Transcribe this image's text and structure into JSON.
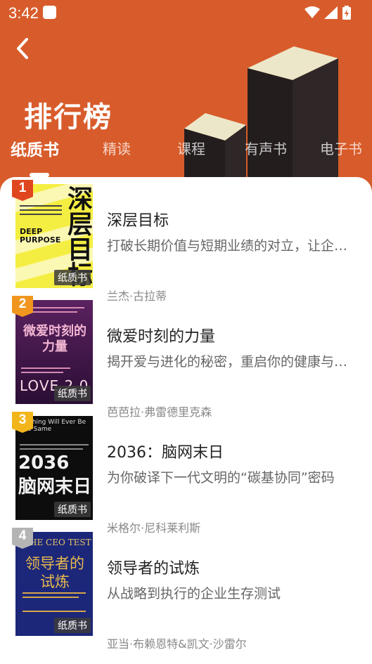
{
  "status": {
    "time": "3:42"
  },
  "header": {
    "title": "排行榜"
  },
  "tabs": [
    {
      "label": "纸质书",
      "active": true
    },
    {
      "label": "精读",
      "active": false
    },
    {
      "label": "课程",
      "active": false
    },
    {
      "label": "有声书",
      "active": false
    },
    {
      "label": "电子书",
      "active": false
    }
  ],
  "books": [
    {
      "rank": "1",
      "title": "深层目标",
      "desc": "打破长期价值与短期业绩的对立，让企业行稳致远",
      "author": "兰杰·古拉蒂",
      "tag": "纸质书",
      "cover_title": "深层目标",
      "cover_sub": "DEEP PURPOSE"
    },
    {
      "rank": "2",
      "title": "微爱时刻的力量",
      "desc": "揭开爱与进化的秘密，重启你的健康与幸福",
      "author": "芭芭拉·弗雷德里克森",
      "tag": "纸质书",
      "cover_title": "微爱时刻的力量",
      "cover_sub": "LOVE 2.0"
    },
    {
      "rank": "3",
      "title": "2036：脑网末日",
      "desc": "为你破译下一代文明的“碳基协同”密码",
      "author": "米格尔·尼科莱利斯",
      "tag": "纸质书",
      "cover_title": "2036 脑网末日",
      "cover_sub": "Nothing Will Ever Be the Same"
    },
    {
      "rank": "4",
      "title": "领导者的试炼",
      "desc": "从战略到执行的企业生存测试",
      "author": "亚当·布赖恩特&凯文·沙雷尔",
      "tag": "纸质书",
      "cover_title": "领导者的试炼",
      "cover_sub": "THE CEO TEST"
    }
  ],
  "colors": {
    "brand": "#d85c2b",
    "rank1": "#e0461e",
    "rank2": "#f0961e",
    "rank3": "#f2b61c",
    "rank4": "#b4b4b4"
  }
}
